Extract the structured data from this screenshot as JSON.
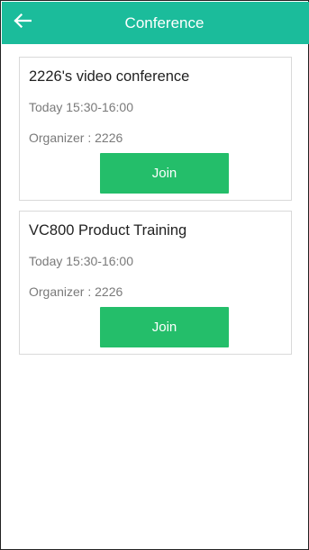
{
  "header": {
    "title": "Conference",
    "back_icon": "back-arrow-icon"
  },
  "conferences": [
    {
      "title": "2226's video conference",
      "time": "Today 15:30-16:00",
      "organizer": "Organizer : 2226",
      "join_label": "Join"
    },
    {
      "title": "VC800 Product Training",
      "time": "Today 15:30-16:00",
      "organizer": "Organizer : 2226",
      "join_label": "Join"
    }
  ],
  "colors": {
    "header_bg": "#1bbc9b",
    "join_bg": "#24be6a"
  }
}
